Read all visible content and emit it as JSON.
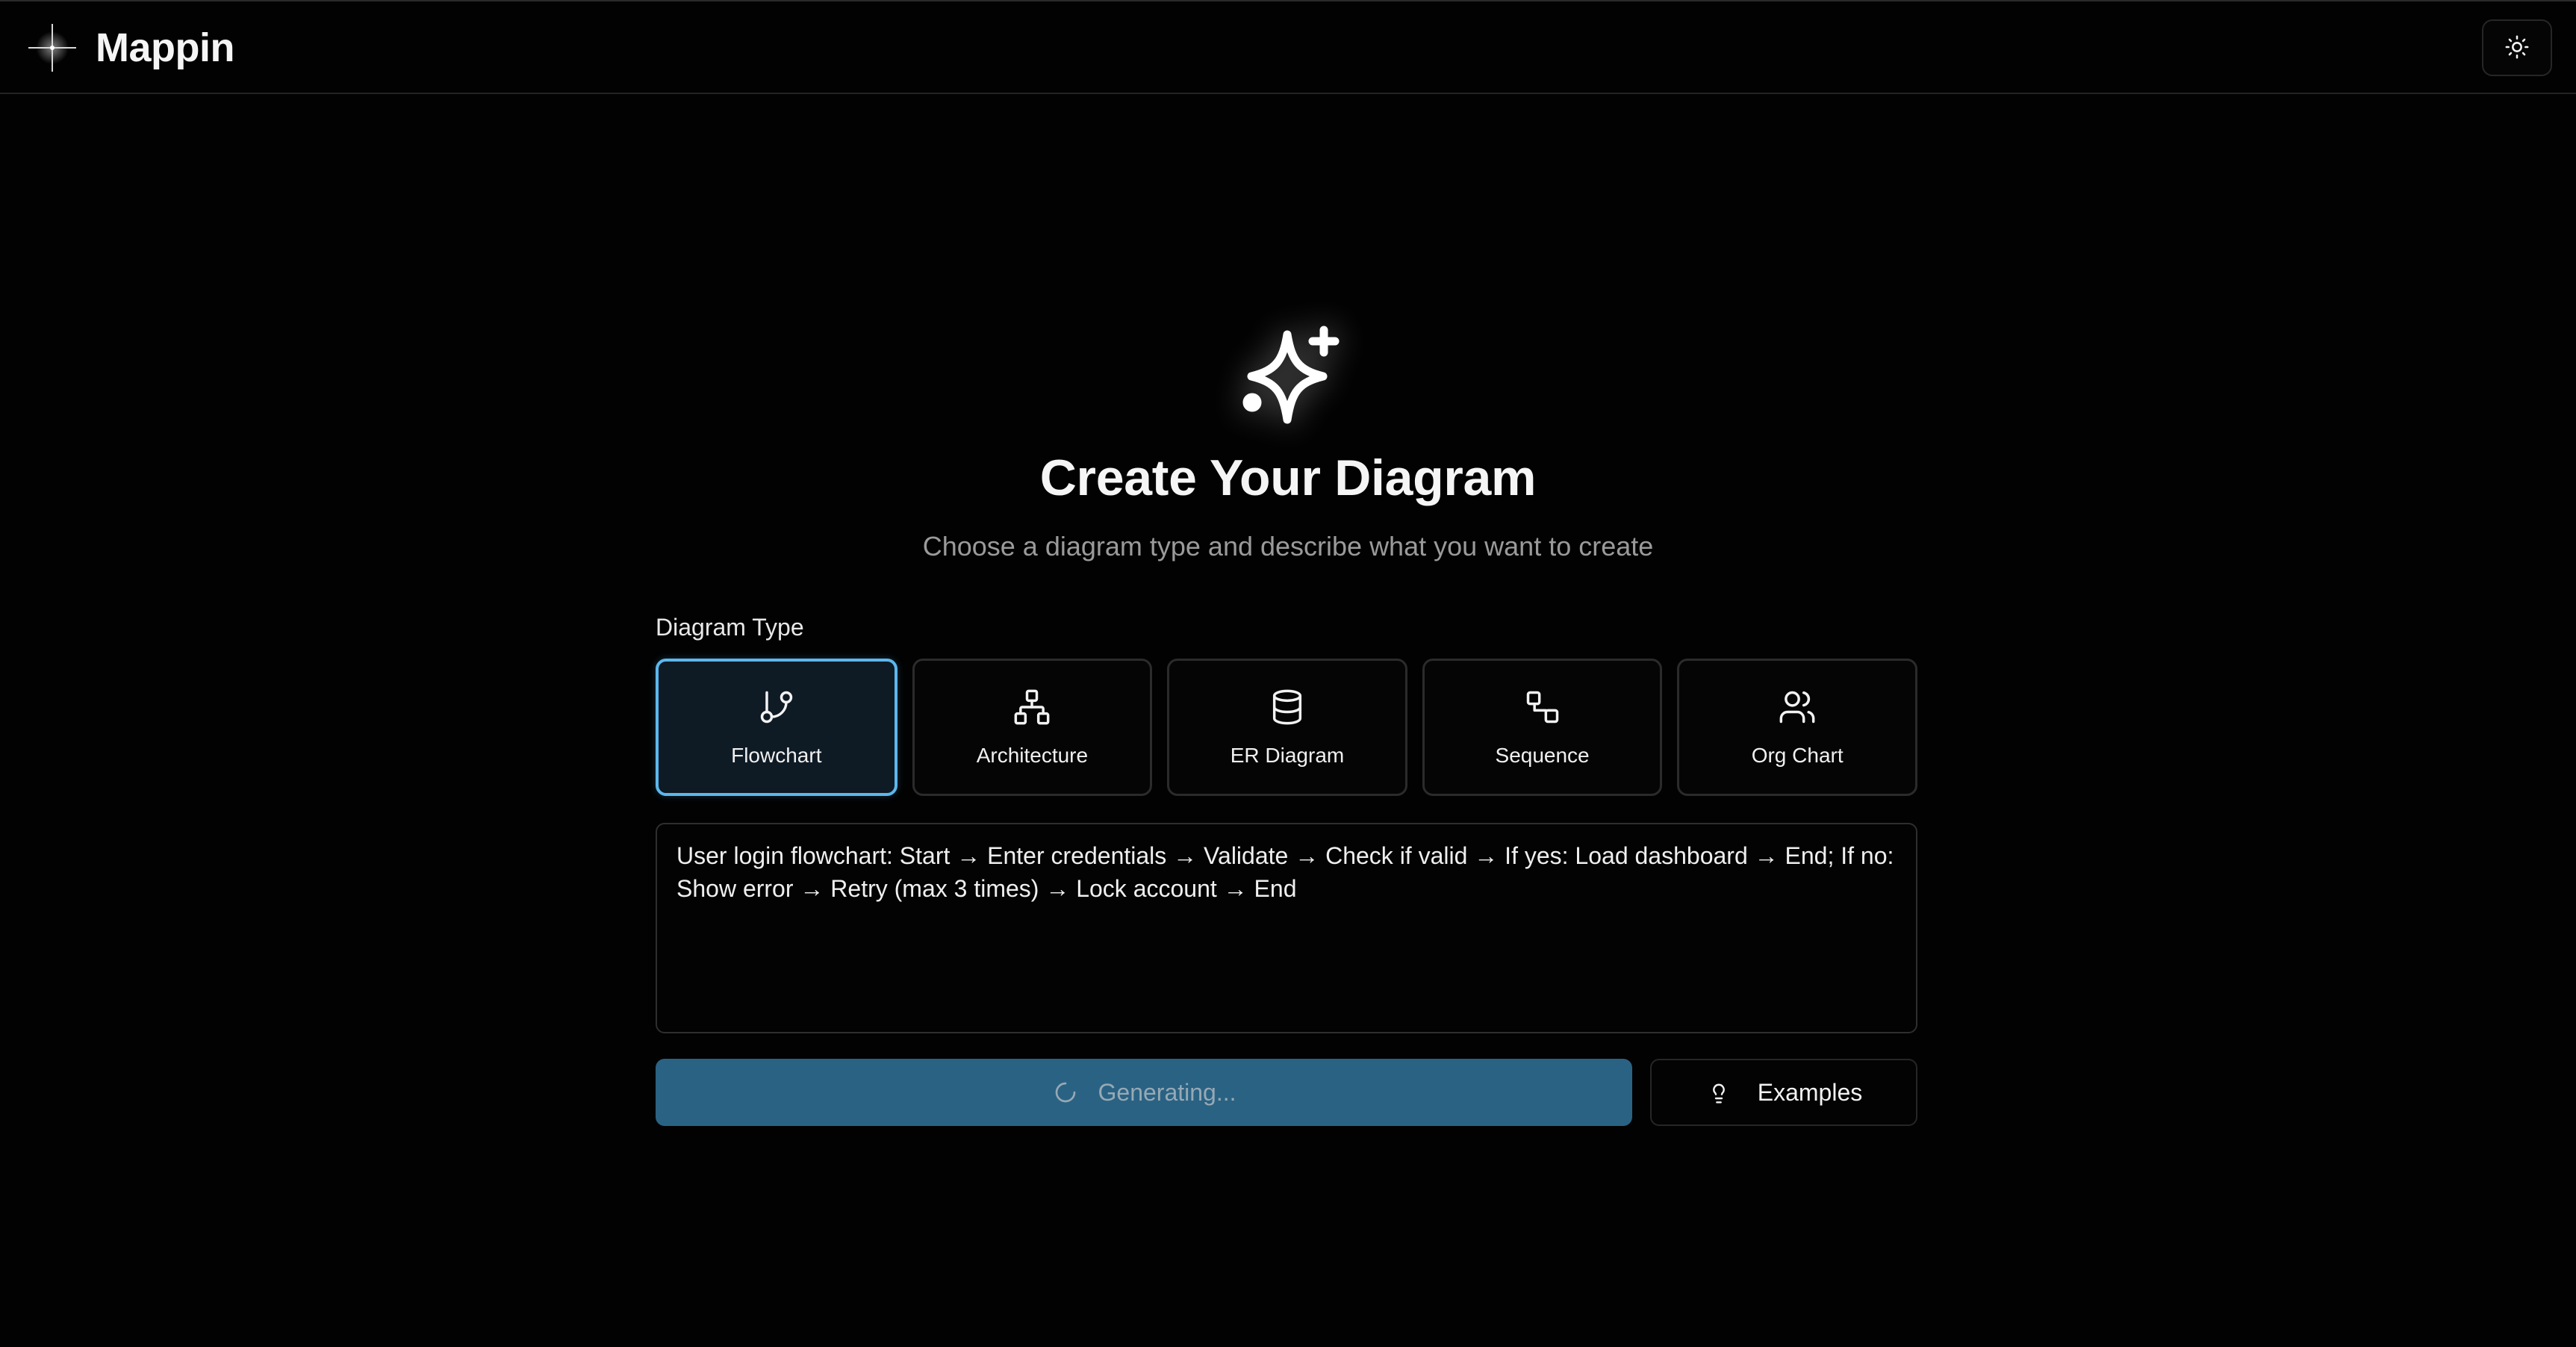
{
  "header": {
    "app_name": "Mappin",
    "logo_icon": "sparkle-logo-icon",
    "theme_toggle_icon": "sun-icon"
  },
  "hero": {
    "icon": "sparkles-icon",
    "title": "Create Your Diagram",
    "subtitle": "Choose a diagram type and describe what you want to create"
  },
  "diagram_type": {
    "label": "Diagram Type",
    "selected": "Flowchart",
    "options": [
      {
        "label": "Flowchart",
        "icon": "git-branch-icon"
      },
      {
        "label": "Architecture",
        "icon": "network-icon"
      },
      {
        "label": "ER Diagram",
        "icon": "database-icon"
      },
      {
        "label": "Sequence",
        "icon": "sequence-icon"
      },
      {
        "label": "Org Chart",
        "icon": "users-icon"
      }
    ]
  },
  "prompt": {
    "value": "User login flowchart: Start → Enter credentials → Validate → Check if valid → If yes: Load dashboard → End; If no: Show error → Retry (max 3 times) → Lock account → End"
  },
  "actions": {
    "generate_label": "Generating...",
    "generate_icon": "loader-icon",
    "examples_label": "Examples",
    "examples_icon": "lightbulb-icon"
  },
  "colors": {
    "background": "#020202",
    "accent": "#5cb7ec",
    "generate_button": "#2a6283",
    "selected_card_bg": "#0e1a24"
  }
}
